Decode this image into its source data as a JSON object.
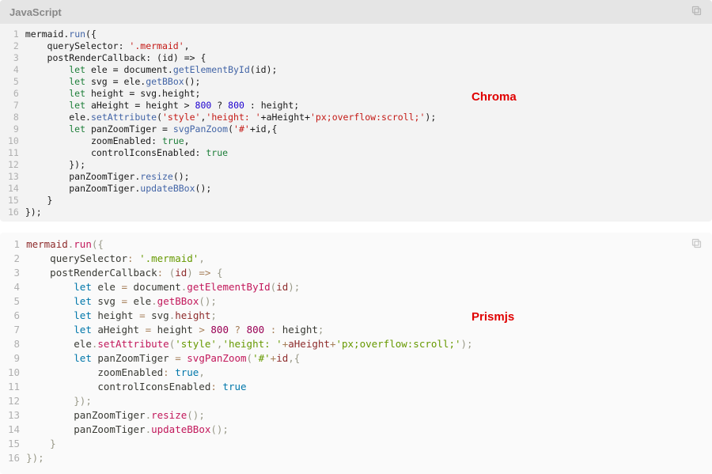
{
  "labels": {
    "chroma": "Chroma",
    "prism": "Prismjs"
  },
  "top": {
    "language": "JavaScript",
    "syntax": "chroma",
    "line_count": 16,
    "tokens": [
      [
        [
          "c-id",
          "mermaid"
        ],
        [
          "c-p",
          "."
        ],
        [
          "c-fn",
          "run"
        ],
        [
          "c-p",
          "({"
        ]
      ],
      [
        [
          "c-p",
          "    querySelector"
        ],
        [
          "c-p",
          ": "
        ],
        [
          "c-str",
          "'.mermaid'"
        ],
        [
          "c-p",
          ","
        ]
      ],
      [
        [
          "c-p",
          "    postRenderCallback"
        ],
        [
          "c-p",
          ": ("
        ],
        [
          "c-id",
          "id"
        ],
        [
          "c-p",
          ") "
        ],
        [
          "c-p",
          "=>"
        ],
        [
          "c-p",
          " {"
        ]
      ],
      [
        [
          "c-p",
          "        "
        ],
        [
          "c-kw",
          "let"
        ],
        [
          "c-p",
          " ele "
        ],
        [
          "c-p",
          "="
        ],
        [
          "c-p",
          " document"
        ],
        [
          "c-p",
          "."
        ],
        [
          "c-fn",
          "getElementById"
        ],
        [
          "c-p",
          "("
        ],
        [
          "c-id",
          "id"
        ],
        [
          "c-p",
          ");"
        ]
      ],
      [
        [
          "c-p",
          "        "
        ],
        [
          "c-kw",
          "let"
        ],
        [
          "c-p",
          " svg "
        ],
        [
          "c-p",
          "="
        ],
        [
          "c-p",
          " ele"
        ],
        [
          "c-p",
          "."
        ],
        [
          "c-fn",
          "getBBox"
        ],
        [
          "c-p",
          "();"
        ]
      ],
      [
        [
          "c-p",
          "        "
        ],
        [
          "c-kw",
          "let"
        ],
        [
          "c-p",
          " height "
        ],
        [
          "c-p",
          "="
        ],
        [
          "c-p",
          " svg"
        ],
        [
          "c-p",
          "."
        ],
        [
          "c-id",
          "height"
        ],
        [
          "c-p",
          ";"
        ]
      ],
      [
        [
          "c-p",
          "        "
        ],
        [
          "c-kw",
          "let"
        ],
        [
          "c-p",
          " aHeight "
        ],
        [
          "c-p",
          "="
        ],
        [
          "c-p",
          " height "
        ],
        [
          "c-p",
          ">"
        ],
        [
          "c-p",
          " "
        ],
        [
          "c-num",
          "800"
        ],
        [
          "c-p",
          " "
        ],
        [
          "c-p",
          "?"
        ],
        [
          "c-p",
          " "
        ],
        [
          "c-num",
          "800"
        ],
        [
          "c-p",
          " "
        ],
        [
          "c-p",
          ":"
        ],
        [
          "c-p",
          " height"
        ],
        [
          "c-p",
          ";"
        ]
      ],
      [
        [
          "c-p",
          "        ele"
        ],
        [
          "c-p",
          "."
        ],
        [
          "c-fn",
          "setAttribute"
        ],
        [
          "c-p",
          "("
        ],
        [
          "c-str",
          "'style'"
        ],
        [
          "c-p",
          ","
        ],
        [
          "c-str",
          "'height: '"
        ],
        [
          "c-p",
          "+"
        ],
        [
          "c-id",
          "aHeight"
        ],
        [
          "c-p",
          "+"
        ],
        [
          "c-str",
          "'px;overflow:scroll;'"
        ],
        [
          "c-p",
          ");"
        ]
      ],
      [
        [
          "c-p",
          "        "
        ],
        [
          "c-kw",
          "let"
        ],
        [
          "c-p",
          " panZoomTiger "
        ],
        [
          "c-p",
          "="
        ],
        [
          "c-p",
          " "
        ],
        [
          "c-fn",
          "svgPanZoom"
        ],
        [
          "c-p",
          "("
        ],
        [
          "c-str",
          "'#'"
        ],
        [
          "c-p",
          "+"
        ],
        [
          "c-id",
          "id"
        ],
        [
          "c-p",
          ",{"
        ]
      ],
      [
        [
          "c-p",
          "            zoomEnabled"
        ],
        [
          "c-p",
          ": "
        ],
        [
          "c-bool",
          "true"
        ],
        [
          "c-p",
          ","
        ]
      ],
      [
        [
          "c-p",
          "            controlIconsEnabled"
        ],
        [
          "c-p",
          ": "
        ],
        [
          "c-bool",
          "true"
        ]
      ],
      [
        [
          "c-p",
          "        });"
        ]
      ],
      [
        [
          "c-p",
          "        panZoomTiger"
        ],
        [
          "c-p",
          "."
        ],
        [
          "c-fn",
          "resize"
        ],
        [
          "c-p",
          "();"
        ]
      ],
      [
        [
          "c-p",
          "        panZoomTiger"
        ],
        [
          "c-p",
          "."
        ],
        [
          "c-fn",
          "updateBBox"
        ],
        [
          "c-p",
          "();"
        ]
      ],
      [
        [
          "c-p",
          "    }"
        ]
      ],
      [
        [
          "c-p",
          "});"
        ]
      ]
    ]
  },
  "bottom": {
    "syntax": "prismjs",
    "line_count": 16,
    "tokens": [
      [
        [
          "p-id",
          "mermaid"
        ],
        [
          "p-punct",
          "."
        ],
        [
          "p-fn",
          "run"
        ],
        [
          "p-punct",
          "({"
        ]
      ],
      [
        [
          "p-plain",
          "    querySelector"
        ],
        [
          "p-op",
          ":"
        ],
        [
          "p-plain",
          " "
        ],
        [
          "p-str",
          "'.mermaid'"
        ],
        [
          "p-punct",
          ","
        ]
      ],
      [
        [
          "p-plain",
          "    postRenderCallback"
        ],
        [
          "p-op",
          ":"
        ],
        [
          "p-plain",
          " "
        ],
        [
          "p-punct",
          "("
        ],
        [
          "p-id",
          "id"
        ],
        [
          "p-punct",
          ")"
        ],
        [
          "p-plain",
          " "
        ],
        [
          "p-op",
          "=>"
        ],
        [
          "p-plain",
          " "
        ],
        [
          "p-punct",
          "{"
        ]
      ],
      [
        [
          "p-plain",
          "        "
        ],
        [
          "p-kw",
          "let"
        ],
        [
          "p-plain",
          " ele "
        ],
        [
          "p-op",
          "="
        ],
        [
          "p-plain",
          " document"
        ],
        [
          "p-punct",
          "."
        ],
        [
          "p-fn",
          "getElementById"
        ],
        [
          "p-punct",
          "("
        ],
        [
          "p-id",
          "id"
        ],
        [
          "p-punct",
          ");"
        ]
      ],
      [
        [
          "p-plain",
          "        "
        ],
        [
          "p-kw",
          "let"
        ],
        [
          "p-plain",
          " svg "
        ],
        [
          "p-op",
          "="
        ],
        [
          "p-plain",
          " ele"
        ],
        [
          "p-punct",
          "."
        ],
        [
          "p-fn",
          "getBBox"
        ],
        [
          "p-punct",
          "();"
        ]
      ],
      [
        [
          "p-plain",
          "        "
        ],
        [
          "p-kw",
          "let"
        ],
        [
          "p-plain",
          " height "
        ],
        [
          "p-op",
          "="
        ],
        [
          "p-plain",
          " svg"
        ],
        [
          "p-punct",
          "."
        ],
        [
          "p-id",
          "height"
        ],
        [
          "p-punct",
          ";"
        ]
      ],
      [
        [
          "p-plain",
          "        "
        ],
        [
          "p-kw",
          "let"
        ],
        [
          "p-plain",
          " aHeight "
        ],
        [
          "p-op",
          "="
        ],
        [
          "p-plain",
          " height "
        ],
        [
          "p-op",
          ">"
        ],
        [
          "p-plain",
          " "
        ],
        [
          "p-num",
          "800"
        ],
        [
          "p-plain",
          " "
        ],
        [
          "p-op",
          "?"
        ],
        [
          "p-plain",
          " "
        ],
        [
          "p-num",
          "800"
        ],
        [
          "p-plain",
          " "
        ],
        [
          "p-op",
          ":"
        ],
        [
          "p-plain",
          " height"
        ],
        [
          "p-punct",
          ";"
        ]
      ],
      [
        [
          "p-plain",
          "        ele"
        ],
        [
          "p-punct",
          "."
        ],
        [
          "p-fn",
          "setAttribute"
        ],
        [
          "p-punct",
          "("
        ],
        [
          "p-str",
          "'style'"
        ],
        [
          "p-punct",
          ","
        ],
        [
          "p-str",
          "'height: '"
        ],
        [
          "p-op",
          "+"
        ],
        [
          "p-id",
          "aHeight"
        ],
        [
          "p-op",
          "+"
        ],
        [
          "p-str",
          "'px;overflow:scroll;'"
        ],
        [
          "p-punct",
          ");"
        ]
      ],
      [
        [
          "p-plain",
          "        "
        ],
        [
          "p-kw",
          "let"
        ],
        [
          "p-plain",
          " panZoomTiger "
        ],
        [
          "p-op",
          "="
        ],
        [
          "p-plain",
          " "
        ],
        [
          "p-fn",
          "svgPanZoom"
        ],
        [
          "p-punct",
          "("
        ],
        [
          "p-str",
          "'#'"
        ],
        [
          "p-op",
          "+"
        ],
        [
          "p-id",
          "id"
        ],
        [
          "p-punct",
          ",{"
        ]
      ],
      [
        [
          "p-plain",
          "            zoomEnabled"
        ],
        [
          "p-op",
          ":"
        ],
        [
          "p-plain",
          " "
        ],
        [
          "p-kw",
          "true"
        ],
        [
          "p-punct",
          ","
        ]
      ],
      [
        [
          "p-plain",
          "            controlIconsEnabled"
        ],
        [
          "p-op",
          ":"
        ],
        [
          "p-plain",
          " "
        ],
        [
          "p-kw",
          "true"
        ]
      ],
      [
        [
          "p-punct",
          "        });"
        ]
      ],
      [
        [
          "p-plain",
          "        panZoomTiger"
        ],
        [
          "p-punct",
          "."
        ],
        [
          "p-fn",
          "resize"
        ],
        [
          "p-punct",
          "();"
        ]
      ],
      [
        [
          "p-plain",
          "        panZoomTiger"
        ],
        [
          "p-punct",
          "."
        ],
        [
          "p-fn",
          "updateBBox"
        ],
        [
          "p-punct",
          "();"
        ]
      ],
      [
        [
          "p-punct",
          "    }"
        ]
      ],
      [
        [
          "p-punct",
          "});"
        ]
      ]
    ]
  }
}
